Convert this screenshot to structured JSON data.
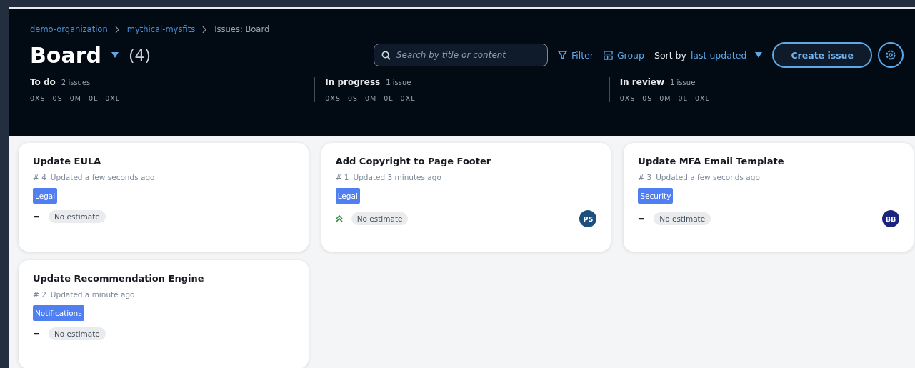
{
  "breadcrumbs": [
    {
      "label": "demo-organization",
      "link": true
    },
    {
      "label": "mythical-mysfits",
      "link": true
    },
    {
      "label": "Issues: Board",
      "link": false
    }
  ],
  "title": "Board",
  "count": "(4)",
  "search": {
    "placeholder": "Search by title or content"
  },
  "toolbar": {
    "filter": "Filter",
    "group": "Group",
    "sort_label": "Sort by",
    "sort_value": "last updated",
    "create": "Create issue"
  },
  "columns": [
    {
      "name": "To do",
      "count": "2 issues",
      "sizes": [
        "0XS",
        "0S",
        "0M",
        "0L",
        "0XL"
      ],
      "cards": [
        {
          "title": "Update EULA",
          "number": "# 4",
          "updated": "Updated a few seconds ago",
          "tag": "Legal",
          "priority_high": false,
          "estimate": "No estimate"
        },
        {
          "title": "Update Recommendation Engine",
          "number": "# 2",
          "updated": "Updated a minute ago",
          "tag": "Notifications",
          "priority_high": false,
          "estimate": "No estimate"
        }
      ]
    },
    {
      "name": "In progress",
      "count": "1 issue",
      "sizes": [
        "0XS",
        "0S",
        "0M",
        "0L",
        "0XL"
      ],
      "cards": [
        {
          "title": "Add Copyright to Page Footer",
          "number": "# 1",
          "updated": "Updated 3 minutes ago",
          "tag": "Legal",
          "priority_high": true,
          "estimate": "No estimate",
          "assignee": {
            "initials": "PS",
            "color": "#1d4f7c"
          }
        }
      ]
    },
    {
      "name": "In review",
      "count": "1 issue",
      "sizes": [
        "0XS",
        "0S",
        "0M",
        "0L",
        "0XL"
      ],
      "cards": [
        {
          "title": "Update MFA Email Template",
          "number": "# 3",
          "updated": "Updated a few seconds ago",
          "tag": "Security",
          "priority_high": false,
          "estimate": "No estimate",
          "assignee": {
            "initials": "BB",
            "color": "#1a237e"
          }
        }
      ]
    }
  ]
}
